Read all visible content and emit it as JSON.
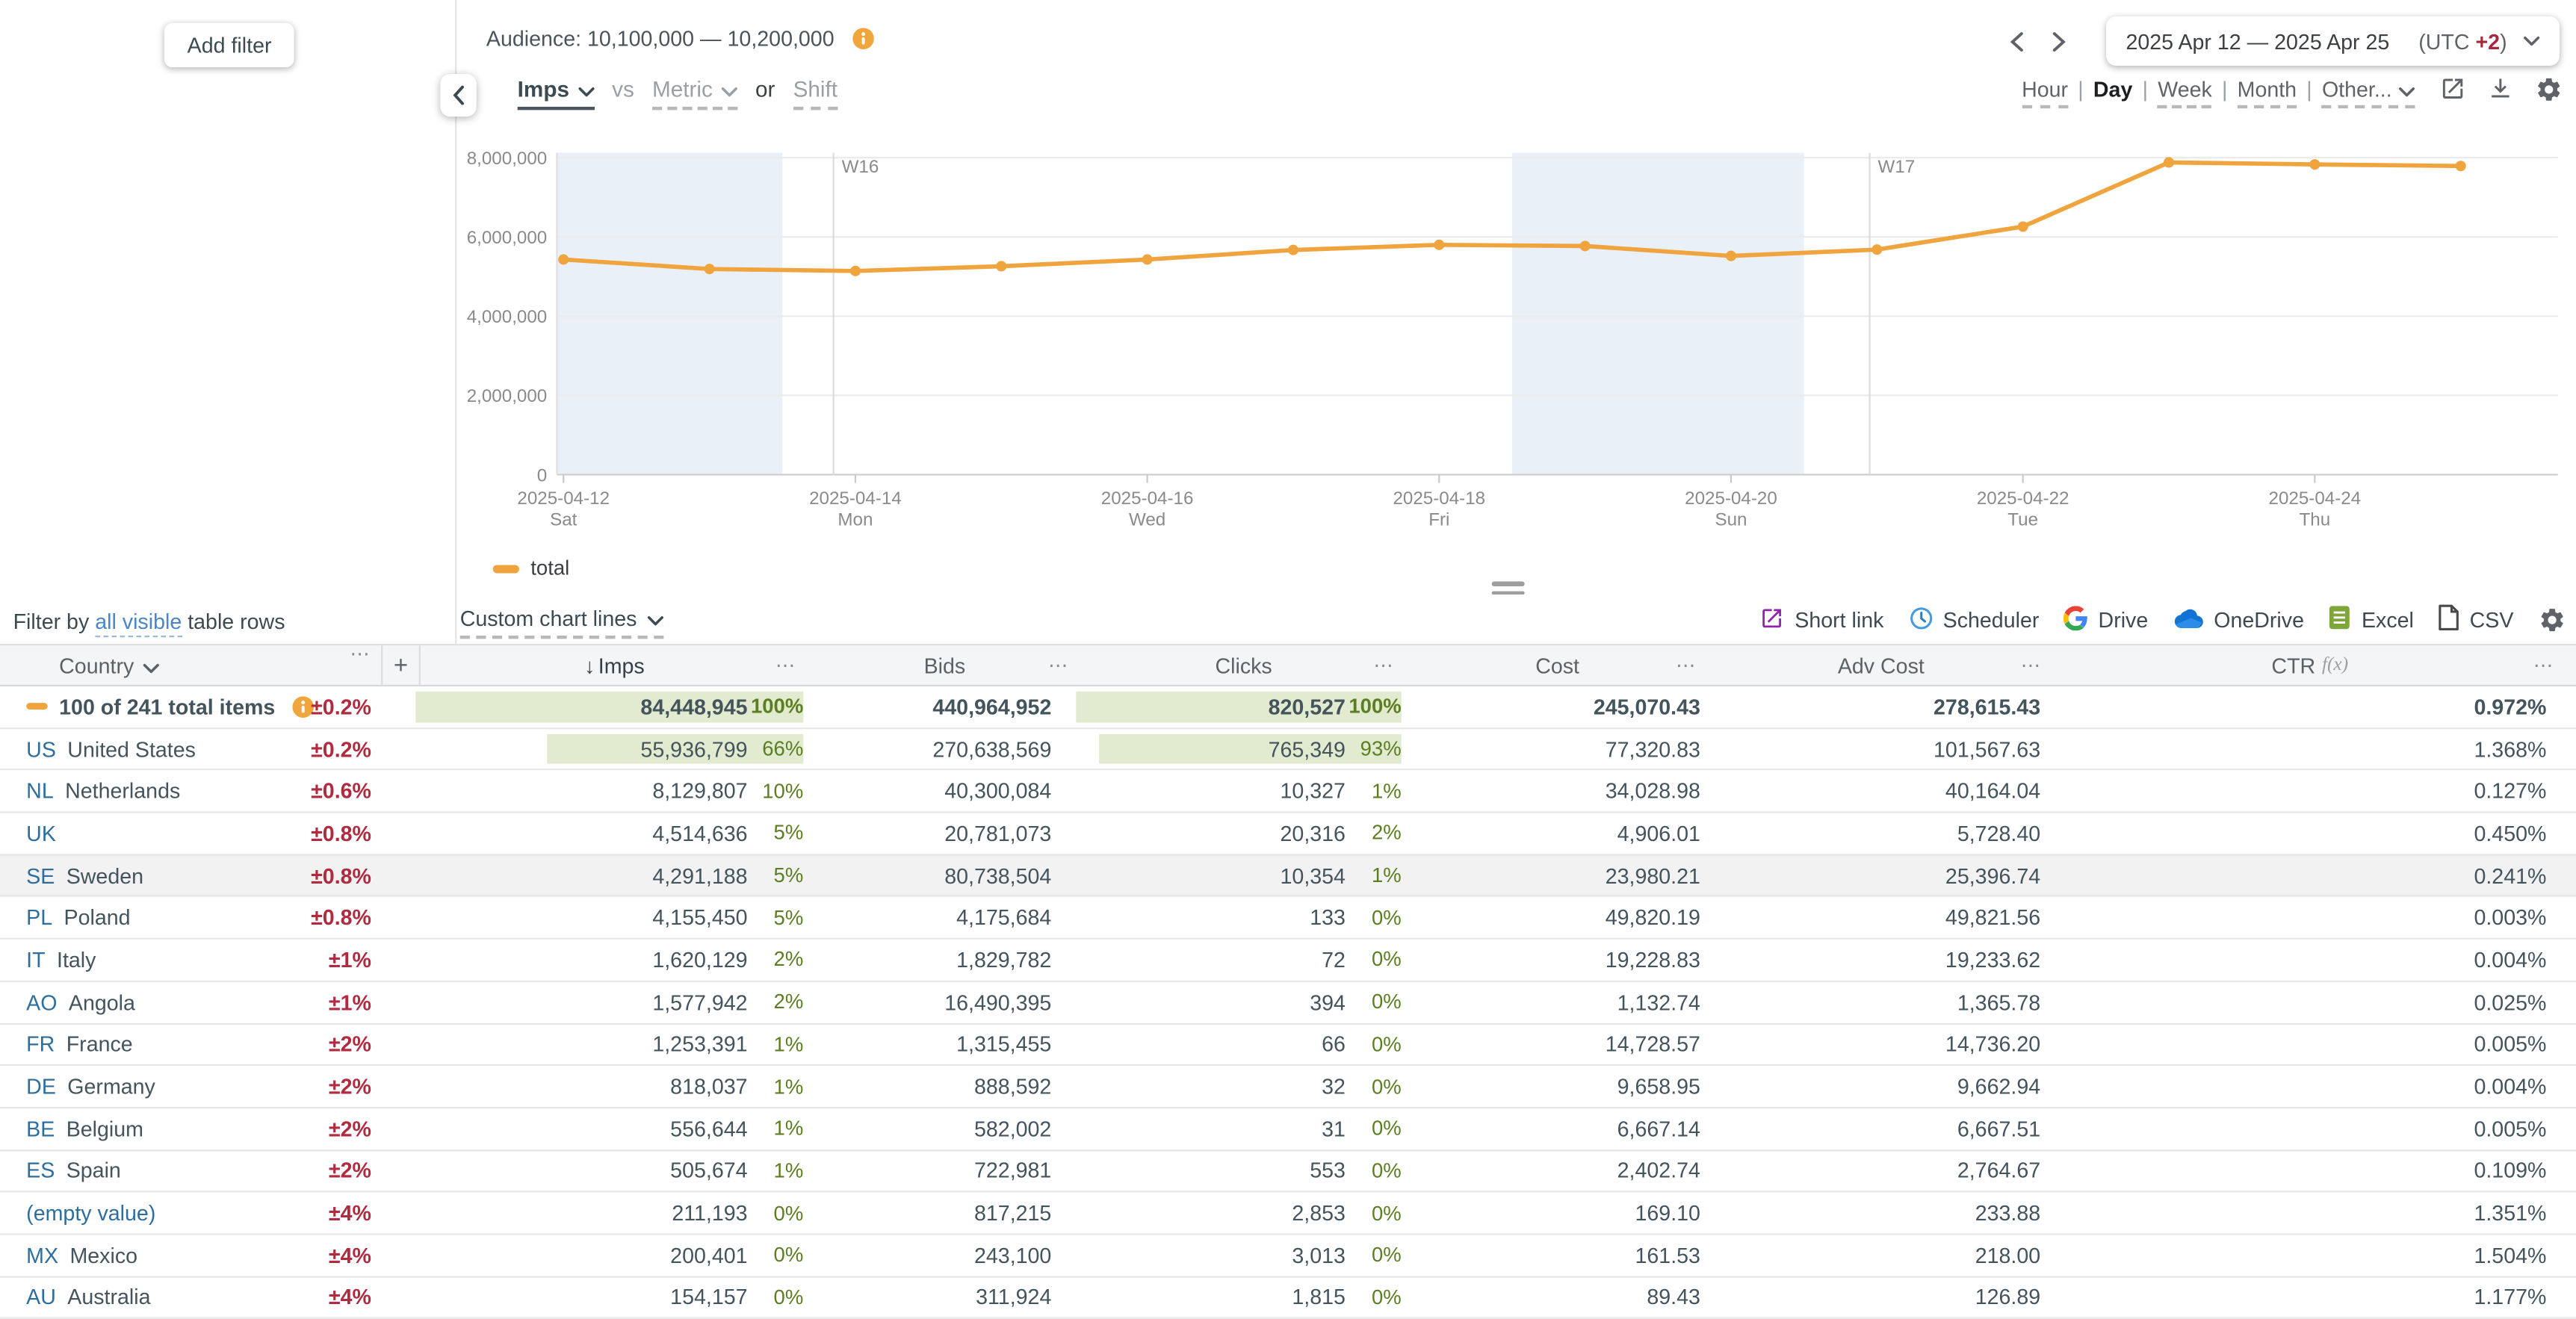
{
  "filters": {
    "add_filter_label": "Add filter",
    "filter_by_prefix": "Filter by",
    "filter_by_link": "all visible",
    "filter_by_suffix": "table rows"
  },
  "header": {
    "audience_label": "Audience: 10,100,000 — 10,200,000",
    "audience_info_icon": "info-icon",
    "date_range": "2025 Apr 12 — 2025 Apr 25",
    "utc_prefix": "(UTC ",
    "utc_offset": "+2",
    "utc_suffix": ")"
  },
  "chart_controls": {
    "metric_selected": "Imps",
    "vs_label": "vs",
    "metric_placeholder": "Metric",
    "or_label": "or",
    "shift_label": "Shift",
    "granularities": [
      {
        "label": "Hour"
      },
      {
        "label": "Day",
        "selected": true
      },
      {
        "label": "Week"
      },
      {
        "label": "Month"
      },
      {
        "label": "Other...",
        "has_chevron": true
      }
    ],
    "top_icons": [
      "open-in-new-icon",
      "download-icon",
      "gear-icon"
    ]
  },
  "chart_data": {
    "type": "line",
    "title": "",
    "xlabel": "",
    "ylabel": "",
    "ylim": [
      0,
      8000000
    ],
    "y_ticks": [
      0,
      2000000,
      4000000,
      6000000,
      8000000
    ],
    "grid": true,
    "legend_position": "bottom-left",
    "x": [
      "2025-04-12",
      "2025-04-13",
      "2025-04-14",
      "2025-04-15",
      "2025-04-16",
      "2025-04-17",
      "2025-04-18",
      "2025-04-19",
      "2025-04-20",
      "2025-04-21",
      "2025-04-22",
      "2025-04-23",
      "2025-04-24",
      "2025-04-25"
    ],
    "series": [
      {
        "name": "total",
        "color": "#f0a43e",
        "values": [
          5430000,
          5190000,
          5140000,
          5260000,
          5430000,
          5670000,
          5800000,
          5770000,
          5520000,
          5680000,
          6260000,
          7880000,
          7830000,
          7790000
        ]
      }
    ],
    "x_tick_labels": [
      {
        "date": "2025-04-12",
        "weekday": "Sat",
        "day_offset": 0
      },
      {
        "date": "2025-04-14",
        "weekday": "Mon",
        "day_offset": 2
      },
      {
        "date": "2025-04-16",
        "weekday": "Wed",
        "day_offset": 4
      },
      {
        "date": "2025-04-18",
        "weekday": "Fri",
        "day_offset": 6
      },
      {
        "date": "2025-04-20",
        "weekday": "Sun",
        "day_offset": 8
      },
      {
        "date": "2025-04-22",
        "weekday": "Tue",
        "day_offset": 10
      },
      {
        "date": "2025-04-24",
        "weekday": "Thu",
        "day_offset": 12
      }
    ],
    "week_markers": [
      {
        "label": "W16",
        "day_offset": 1.85
      },
      {
        "label": "W17",
        "day_offset": 8.95
      }
    ],
    "weekend_bands": [
      {
        "start_day": -0.3,
        "end_day": 1.5
      },
      {
        "start_day": 6.5,
        "end_day": 8.5
      }
    ],
    "weekend_band_color": "#e9f0f8"
  },
  "legend": {
    "series_label": "total"
  },
  "toolbar": {
    "custom_chart_lines": "Custom chart lines",
    "exports": [
      {
        "label": "Short link",
        "icon": "short-link-icon"
      },
      {
        "label": "Scheduler",
        "icon": "clock-icon"
      },
      {
        "label": "Drive",
        "icon": "google-drive-icon"
      },
      {
        "label": "OneDrive",
        "icon": "onedrive-cloud-icon"
      },
      {
        "label": "Excel",
        "icon": "excel-file-icon"
      },
      {
        "label": "CSV",
        "icon": "csv-file-icon"
      }
    ],
    "settings_icon": "gear-icon"
  },
  "table": {
    "headers": {
      "country": "Country",
      "menu": "⋯",
      "add_column": "+",
      "sort_icon": "↓",
      "imps": "Imps",
      "bids": "Bids",
      "clicks": "Clicks",
      "cost": "Cost",
      "adv_cost": "Adv Cost",
      "ctr": "CTR",
      "ctr_suffix": "f(x)"
    },
    "rows": [
      {
        "swatch": true,
        "code": "",
        "name": "100 of 241 total items",
        "info": true,
        "total": true,
        "pm": "±0.2%",
        "imps": "84,448,945",
        "imps_pct": "100%",
        "imps_bar": 100,
        "bids": "440,964,952",
        "clicks": "820,527",
        "clicks_pct": "100%",
        "clicks_bar": 100,
        "cost": "245,070.43",
        "adv_cost": "278,615.43",
        "ctr": "0.972%"
      },
      {
        "code": "US",
        "name": "United States",
        "pm": "±0.2%",
        "imps": "55,936,799",
        "imps_pct": "66%",
        "imps_bar": 66,
        "bids": "270,638,569",
        "clicks": "765,349",
        "clicks_pct": "93%",
        "clicks_bar": 93,
        "cost": "77,320.83",
        "adv_cost": "101,567.63",
        "ctr": "1.368%"
      },
      {
        "code": "NL",
        "name": "Netherlands",
        "pm": "±0.6%",
        "imps": "8,129,807",
        "imps_pct": "10%",
        "imps_bar": 10,
        "bids": "40,300,084",
        "clicks": "10,327",
        "clicks_pct": "1%",
        "clicks_bar": 1,
        "cost": "34,028.98",
        "adv_cost": "40,164.04",
        "ctr": "0.127%"
      },
      {
        "code": "UK",
        "name": "",
        "pm": "±0.8%",
        "imps": "4,514,636",
        "imps_pct": "5%",
        "imps_bar": 5,
        "bids": "20,781,073",
        "clicks": "20,316",
        "clicks_pct": "2%",
        "clicks_bar": 2,
        "cost": "4,906.01",
        "adv_cost": "5,728.40",
        "ctr": "0.450%"
      },
      {
        "code": "SE",
        "name": "Sweden",
        "highlight": true,
        "pm": "±0.8%",
        "imps": "4,291,188",
        "imps_pct": "5%",
        "imps_bar": 5,
        "bids": "80,738,504",
        "clicks": "10,354",
        "clicks_pct": "1%",
        "clicks_bar": 1,
        "cost": "23,980.21",
        "adv_cost": "25,396.74",
        "ctr": "0.241%"
      },
      {
        "code": "PL",
        "name": "Poland",
        "pm": "±0.8%",
        "imps": "4,155,450",
        "imps_pct": "5%",
        "imps_bar": 5,
        "bids": "4,175,684",
        "clicks": "133",
        "clicks_pct": "0%",
        "clicks_bar": 0,
        "cost": "49,820.19",
        "adv_cost": "49,821.56",
        "ctr": "0.003%"
      },
      {
        "code": "IT",
        "name": "Italy",
        "pm": "±1%",
        "imps": "1,620,129",
        "imps_pct": "2%",
        "imps_bar": 2,
        "bids": "1,829,782",
        "clicks": "72",
        "clicks_pct": "0%",
        "clicks_bar": 0,
        "cost": "19,228.83",
        "adv_cost": "19,233.62",
        "ctr": "0.004%"
      },
      {
        "code": "AO",
        "name": "Angola",
        "pm": "±1%",
        "imps": "1,577,942",
        "imps_pct": "2%",
        "imps_bar": 2,
        "bids": "16,490,395",
        "clicks": "394",
        "clicks_pct": "0%",
        "clicks_bar": 0,
        "cost": "1,132.74",
        "adv_cost": "1,365.78",
        "ctr": "0.025%"
      },
      {
        "code": "FR",
        "name": "France",
        "pm": "±2%",
        "imps": "1,253,391",
        "imps_pct": "1%",
        "imps_bar": 1,
        "bids": "1,315,455",
        "clicks": "66",
        "clicks_pct": "0%",
        "clicks_bar": 0,
        "cost": "14,728.57",
        "adv_cost": "14,736.20",
        "ctr": "0.005%"
      },
      {
        "code": "DE",
        "name": "Germany",
        "pm": "±2%",
        "imps": "818,037",
        "imps_pct": "1%",
        "imps_bar": 1,
        "bids": "888,592",
        "clicks": "32",
        "clicks_pct": "0%",
        "clicks_bar": 0,
        "cost": "9,658.95",
        "adv_cost": "9,662.94",
        "ctr": "0.004%"
      },
      {
        "code": "BE",
        "name": "Belgium",
        "pm": "±2%",
        "imps": "556,644",
        "imps_pct": "1%",
        "imps_bar": 1,
        "bids": "582,002",
        "clicks": "31",
        "clicks_pct": "0%",
        "clicks_bar": 0,
        "cost": "6,667.14",
        "adv_cost": "6,667.51",
        "ctr": "0.005%"
      },
      {
        "code": "ES",
        "name": "Spain",
        "pm": "±2%",
        "imps": "505,674",
        "imps_pct": "1%",
        "imps_bar": 1,
        "bids": "722,981",
        "clicks": "553",
        "clicks_pct": "0%",
        "clicks_bar": 0,
        "cost": "2,402.74",
        "adv_cost": "2,764.67",
        "ctr": "0.109%"
      },
      {
        "code": "",
        "name": "(empty value)",
        "name_link": true,
        "pm": "±4%",
        "imps": "211,193",
        "imps_pct": "0%",
        "imps_bar": 0,
        "bids": "817,215",
        "clicks": "2,853",
        "clicks_pct": "0%",
        "clicks_bar": 0,
        "cost": "169.10",
        "adv_cost": "233.88",
        "ctr": "1.351%"
      },
      {
        "code": "MX",
        "name": "Mexico",
        "pm": "±4%",
        "imps": "200,401",
        "imps_pct": "0%",
        "imps_bar": 0,
        "bids": "243,100",
        "clicks": "3,013",
        "clicks_pct": "0%",
        "clicks_bar": 0,
        "cost": "161.53",
        "adv_cost": "218.00",
        "ctr": "1.504%"
      },
      {
        "code": "AU",
        "name": "Australia",
        "pm": "±4%",
        "imps": "154,157",
        "imps_pct": "0%",
        "imps_bar": 0,
        "bids": "311,924",
        "clicks": "1,815",
        "clicks_pct": "0%",
        "clicks_bar": 0,
        "cost": "89.43",
        "adv_cost": "126.89",
        "ctr": "1.177%"
      }
    ]
  }
}
